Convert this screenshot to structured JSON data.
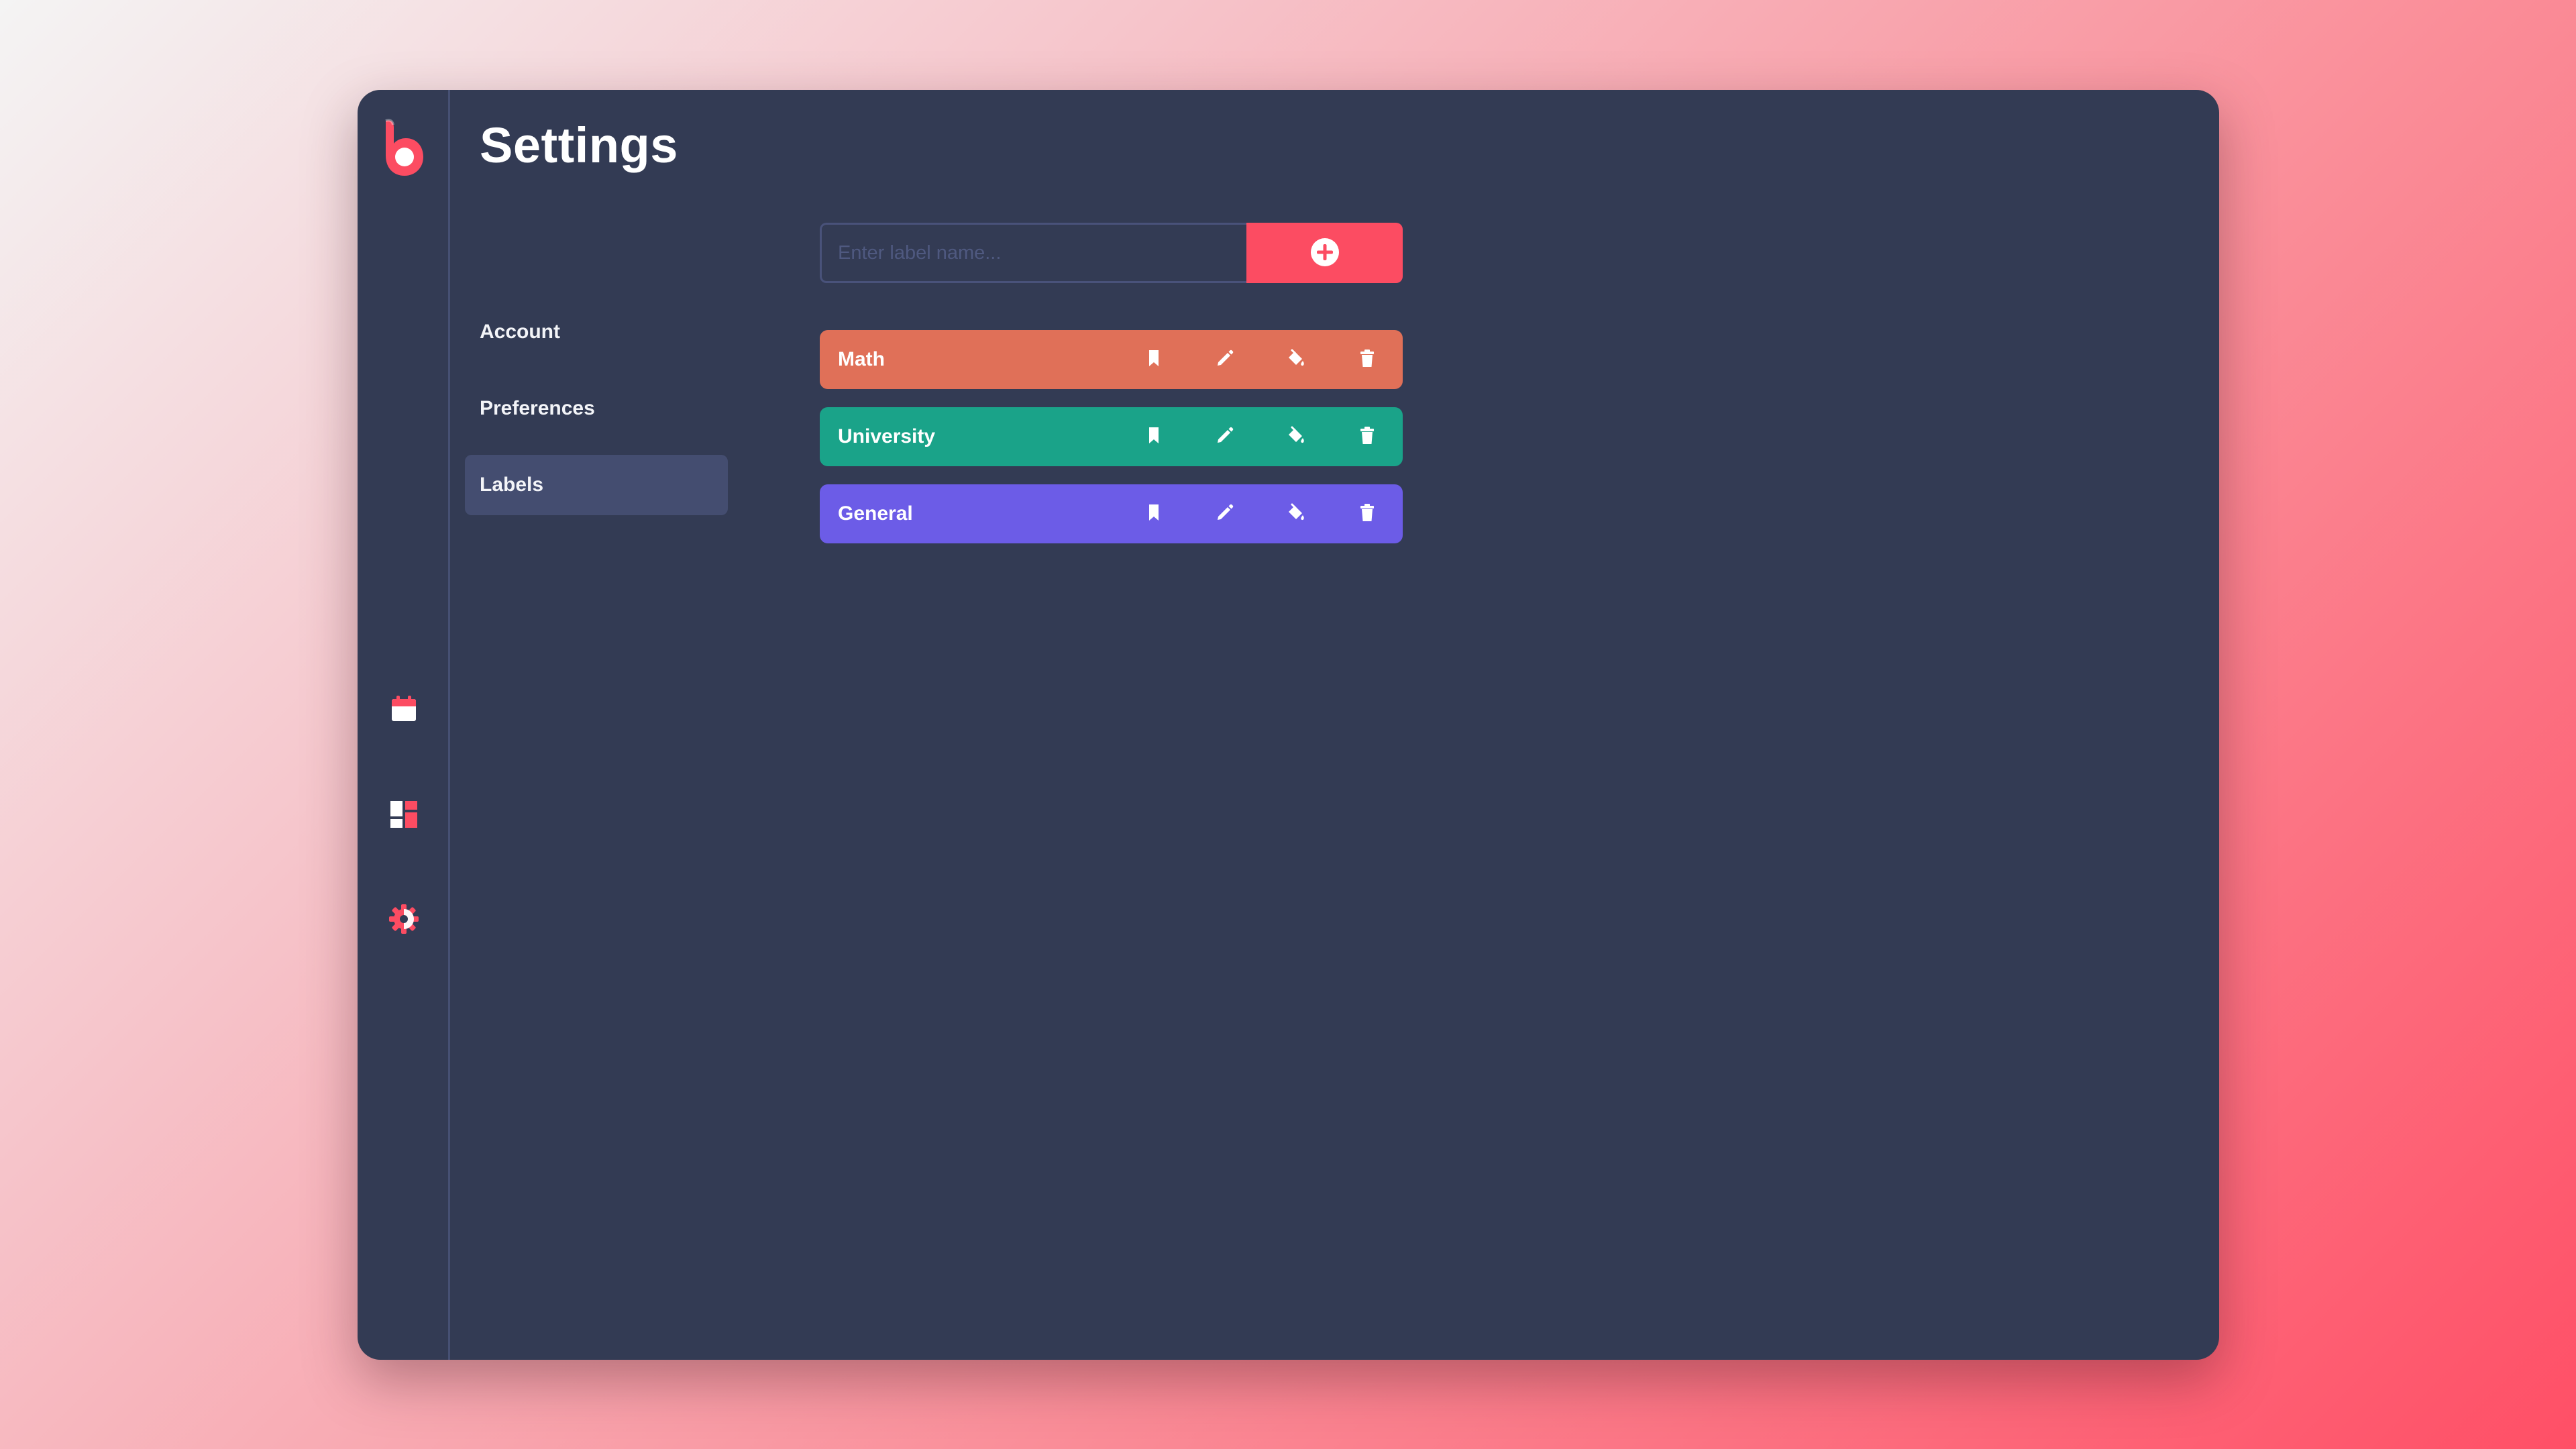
{
  "page": {
    "title": "Settings"
  },
  "subnav": {
    "items": [
      {
        "label": "Account",
        "active": false
      },
      {
        "label": "Preferences",
        "active": false
      },
      {
        "label": "Labels",
        "active": true
      }
    ]
  },
  "rail": {
    "icons": [
      "calendar-icon",
      "dashboard-icon",
      "gear-icon"
    ],
    "accent": "#fc4c62"
  },
  "labels_form": {
    "input_placeholder": "Enter label name...",
    "input_value": "",
    "add_button_icon": "plus-circle-icon"
  },
  "labels": [
    {
      "name": "Math",
      "color": "#e07058"
    },
    {
      "name": "University",
      "color": "#1aa389"
    },
    {
      "name": "General",
      "color": "#6c5ce7"
    }
  ],
  "row_actions": [
    "bookmark-icon",
    "pencil-icon",
    "paint-bucket-icon",
    "trash-icon"
  ]
}
